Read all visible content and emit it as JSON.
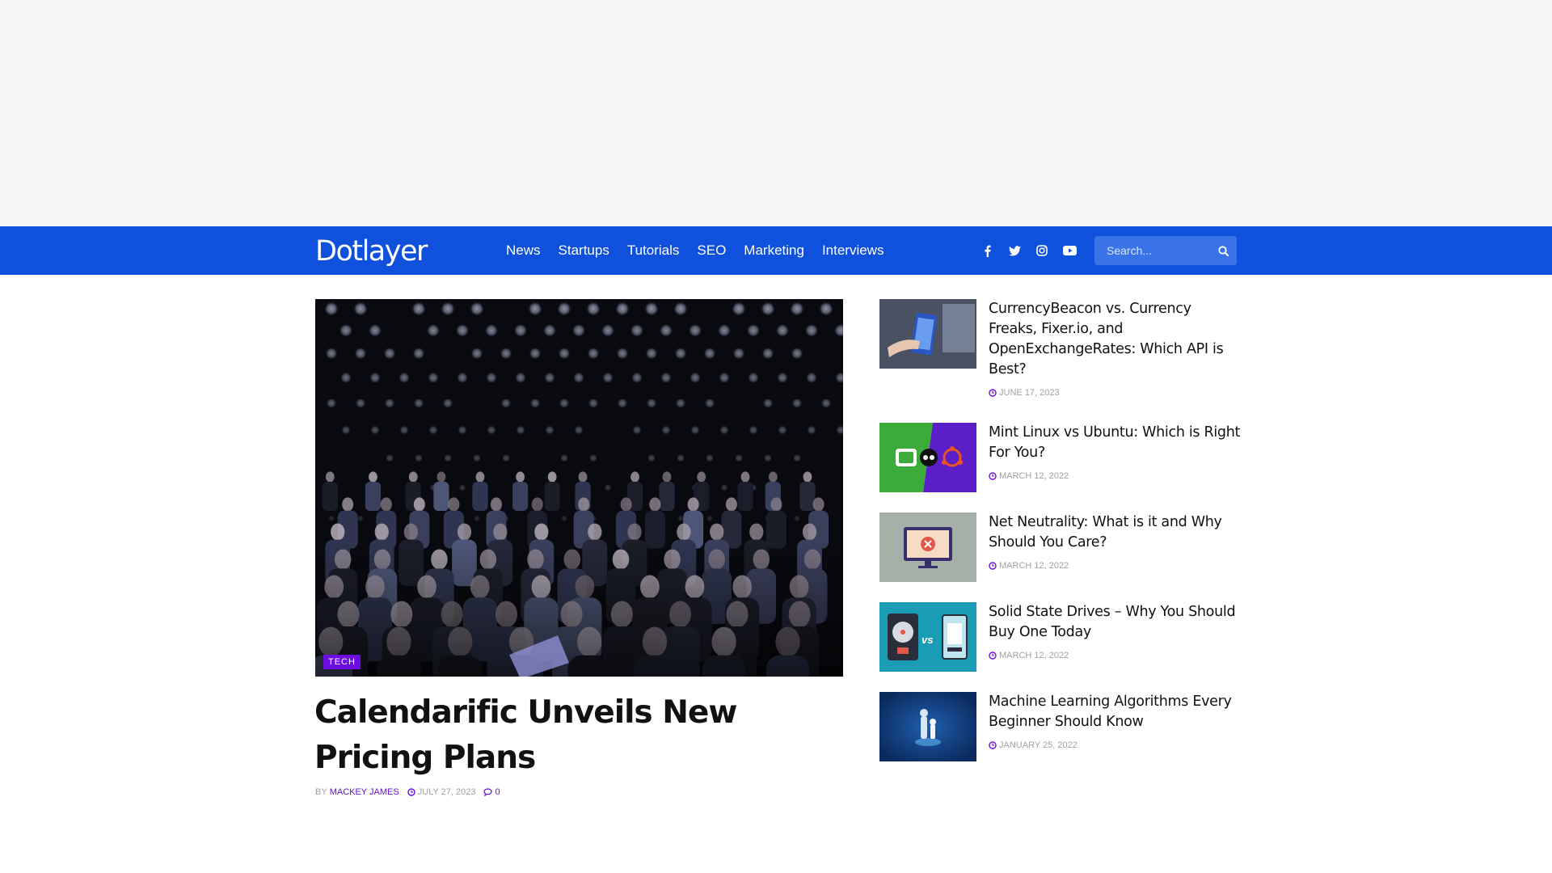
{
  "site": {
    "logo": "Dotlayer"
  },
  "nav": {
    "items": [
      "News",
      "Startups",
      "Tutorials",
      "SEO",
      "Marketing",
      "Interviews"
    ]
  },
  "socials": [
    "facebook-icon",
    "twitter-icon",
    "instagram-icon",
    "youtube-icon"
  ],
  "search": {
    "placeholder": "Search..."
  },
  "featured": {
    "category": "TECH",
    "title": "Calendarific Unveils New Pricing Plans",
    "by_label": "BY",
    "author": "MACKEY JAMES",
    "date": "JULY 27, 2023",
    "comments": "0"
  },
  "sidebar": {
    "items": [
      {
        "title": "CurrencyBeacon vs. Currency Freaks, Fixer.io, and OpenExchangeRates: Which API is Best?",
        "date": "JUNE 17, 2023"
      },
      {
        "title": "Mint Linux vs Ubuntu: Which is Right For You?",
        "date": "MARCH 12, 2022"
      },
      {
        "title": "Net Neutrality: What is it and Why Should You Care?",
        "date": "MARCH 12, 2022"
      },
      {
        "title": "Solid State Drives – Why You Should Buy One Today",
        "date": "MARCH 12, 2022"
      },
      {
        "title": "Machine Learning Algorithms Every Beginner Should Know",
        "date": "JANUARY 25, 2022"
      }
    ]
  },
  "thumb_labels": {
    "vs": "vs"
  },
  "colors": {
    "nav_bg": "#0f50dc",
    "accent": "#6a0dde",
    "ad_bg": "#f5f5f5"
  }
}
